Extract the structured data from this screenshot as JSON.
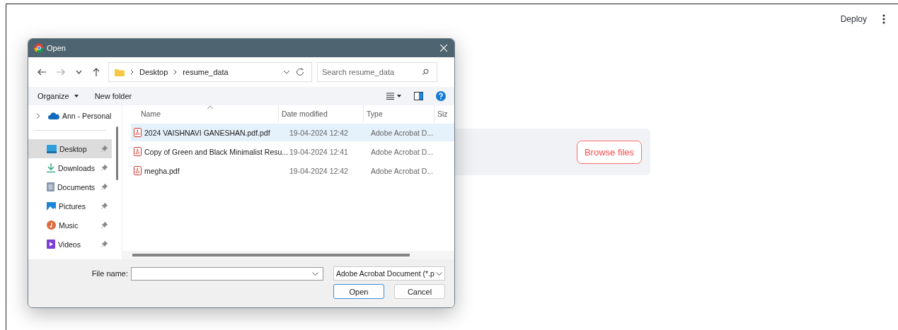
{
  "app": {
    "deploy": "Deploy",
    "browse_button": "Browse files"
  },
  "dialog": {
    "title": "Open",
    "breadcrumb": [
      "Desktop",
      "resume_data"
    ],
    "search": {
      "placeholder": "Search resume_data"
    },
    "toolbar": [
      "Organize",
      "New folder"
    ],
    "quick_root": {
      "label": "Ann - Personal",
      "expanded": false
    },
    "nav": [
      {
        "label": "Desktop",
        "kind": "desktop",
        "selected": true,
        "pinned": true
      },
      {
        "label": "Downloads",
        "kind": "downloads",
        "selected": false,
        "pinned": true
      },
      {
        "label": "Documents",
        "kind": "documents",
        "selected": false,
        "pinned": true
      },
      {
        "label": "Pictures",
        "kind": "pictures",
        "selected": false,
        "pinned": true
      },
      {
        "label": "Music",
        "kind": "music",
        "selected": false,
        "pinned": true
      },
      {
        "label": "Videos",
        "kind": "videos",
        "selected": false,
        "pinned": true
      }
    ],
    "columns": [
      "Name",
      "Date modified",
      "Type",
      "Siz"
    ],
    "rows": [
      {
        "name": "2024 VAISHNAVI GANESHAN.pdf.pdf",
        "date": "19-04-2024 12:42",
        "type": "Adobe Acrobat D...",
        "selected": true
      },
      {
        "name": "Copy of Green and Black Minimalist Resu...",
        "date": "19-04-2024 12:41",
        "type": "Adobe Acrobat D...",
        "selected": false
      },
      {
        "name": "megha.pdf",
        "date": "19-04-2024 12:42",
        "type": "Adobe Acrobat D...",
        "selected": false
      }
    ],
    "file_name": {
      "label": "File name:"
    },
    "file_type": "Adobe Acrobat Document (*.p",
    "buttons": [
      "Open",
      "Cancel"
    ]
  }
}
